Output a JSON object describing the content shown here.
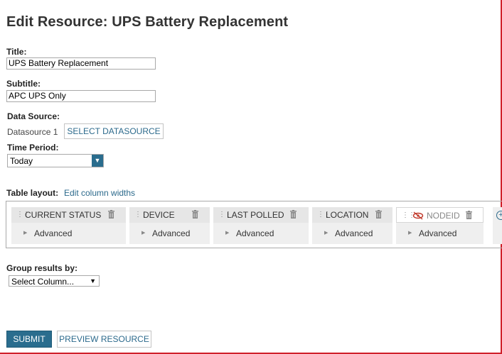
{
  "page": {
    "title": "Edit Resource: UPS Battery Replacement"
  },
  "form": {
    "title_label": "Title:",
    "title_value": "UPS Battery Replacement",
    "subtitle_label": "Subtitle:",
    "subtitle_value": "APC UPS Only",
    "datasource_label": "Data Source:",
    "datasource_name": "Datasource 1",
    "select_datasource_button": "SELECT DATASOURCE",
    "time_period_label": "Time Period:",
    "time_period_value": "Today",
    "table_layout_label": "Table layout:",
    "edit_column_widths_link": "Edit column widths",
    "group_by_label": "Group results by:",
    "group_by_value": "Select Column..."
  },
  "columns": [
    {
      "name": "CURRENT STATUS",
      "advanced": "Advanced",
      "disabled": false
    },
    {
      "name": "DEVICE",
      "advanced": "Advanced",
      "disabled": false
    },
    {
      "name": "LAST POLLED",
      "advanced": "Advanced",
      "disabled": false
    },
    {
      "name": "LOCATION",
      "advanced": "Advanced",
      "disabled": false
    },
    {
      "name": "NODEID",
      "advanced": "Advanced",
      "disabled": true
    }
  ],
  "actions": {
    "submit": "SUBMIT",
    "preview": "PREVIEW RESOURCE"
  },
  "icons": {
    "drag": "drag-handle-icon",
    "trash": "trash-icon",
    "hidden": "hidden-eye-icon",
    "add": "add-column-icon",
    "expand": "triangle-right-icon"
  },
  "colors": {
    "accent": "#2a6d8e",
    "link": "#2c6a8c",
    "border_red": "#d0202a",
    "hidden_icon": "#c0392b"
  }
}
